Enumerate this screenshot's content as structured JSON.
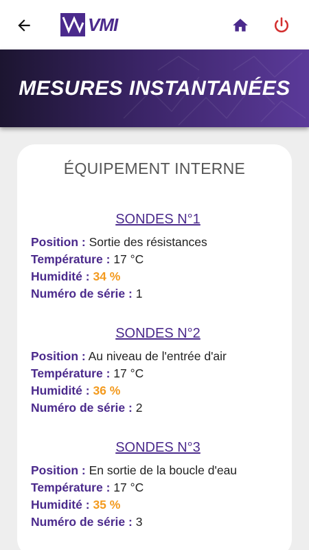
{
  "header": {
    "logo_text": "VMI",
    "icons": {
      "back": "arrow-left-icon",
      "home": "home-icon",
      "power": "power-icon"
    },
    "colors": {
      "brand": "#4b2a8c",
      "power": "#d32f2f"
    }
  },
  "banner": {
    "title": "MESURES INSTANTANÉES"
  },
  "card": {
    "title": "ÉQUIPEMENT INTERNE",
    "labels": {
      "position": "Position :",
      "temperature": "Température :",
      "humidity": "Humidité :",
      "serial": "Numéro de série :"
    },
    "sondes": [
      {
        "title": "SONDES N°1",
        "position": "Sortie des résistances",
        "temperature": "17 °C",
        "humidity": "34 %",
        "serial": "1"
      },
      {
        "title": "SONDES N°2",
        "position": "Au niveau de l'entrée d'air",
        "temperature": "17 °C",
        "humidity": "36 %",
        "serial": "2"
      },
      {
        "title": "SONDES N°3",
        "position": "En sortie de la boucle d'eau",
        "temperature": "17 °C",
        "humidity": "35 %",
        "serial": "3"
      }
    ]
  }
}
